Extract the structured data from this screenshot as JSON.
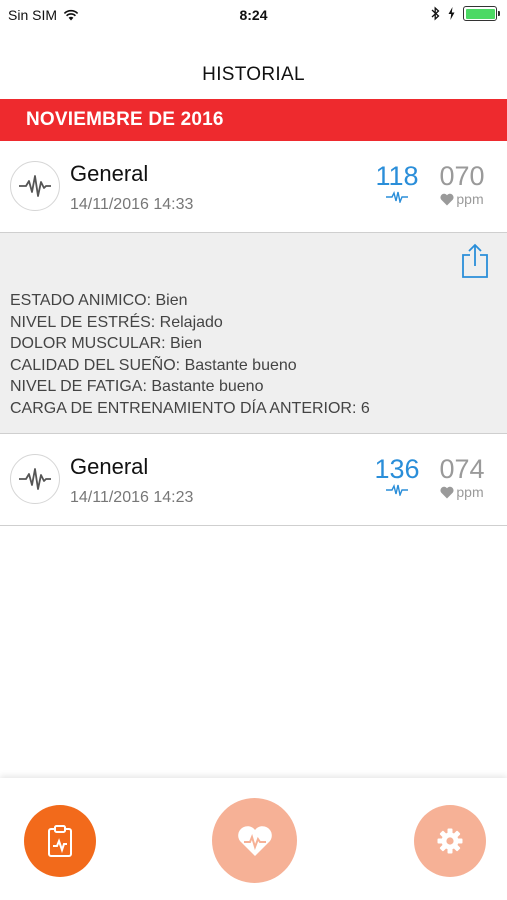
{
  "status_bar": {
    "carrier": "Sin SIM",
    "time": "8:24"
  },
  "header": {
    "title": "HISTORIAL"
  },
  "section": {
    "month": "NOVIEMBRE DE 2016"
  },
  "records": [
    {
      "title": "General",
      "datetime": "14/11/2016 14:33",
      "hrv": "118",
      "bpm": "070",
      "unit": "ppm"
    },
    {
      "title": "General",
      "datetime": "14/11/2016 14:23",
      "hrv": "136",
      "bpm": "074",
      "unit": "ppm"
    }
  ],
  "details": {
    "lines": [
      "ESTADO ANIMICO: Bien",
      "NIVEL DE ESTRÉS: Relajado",
      "DOLOR MUSCULAR: Bien",
      "CALIDAD DEL SUEÑO: Bastante bueno",
      "NIVEL DE FATIGA: Bastante bueno",
      "CARGA DE ENTRENAMIENTO DÍA ANTERIOR: 6"
    ]
  },
  "tabbar": {
    "items": [
      "clipboard-chart-icon",
      "heart-pulse-icon",
      "gear-icon"
    ]
  },
  "colors": {
    "accent_red": "#ee2a2e",
    "hrv_blue": "#2a8ed9",
    "tab_active": "#f26a1b",
    "tab_inactive": "#f6b196"
  }
}
